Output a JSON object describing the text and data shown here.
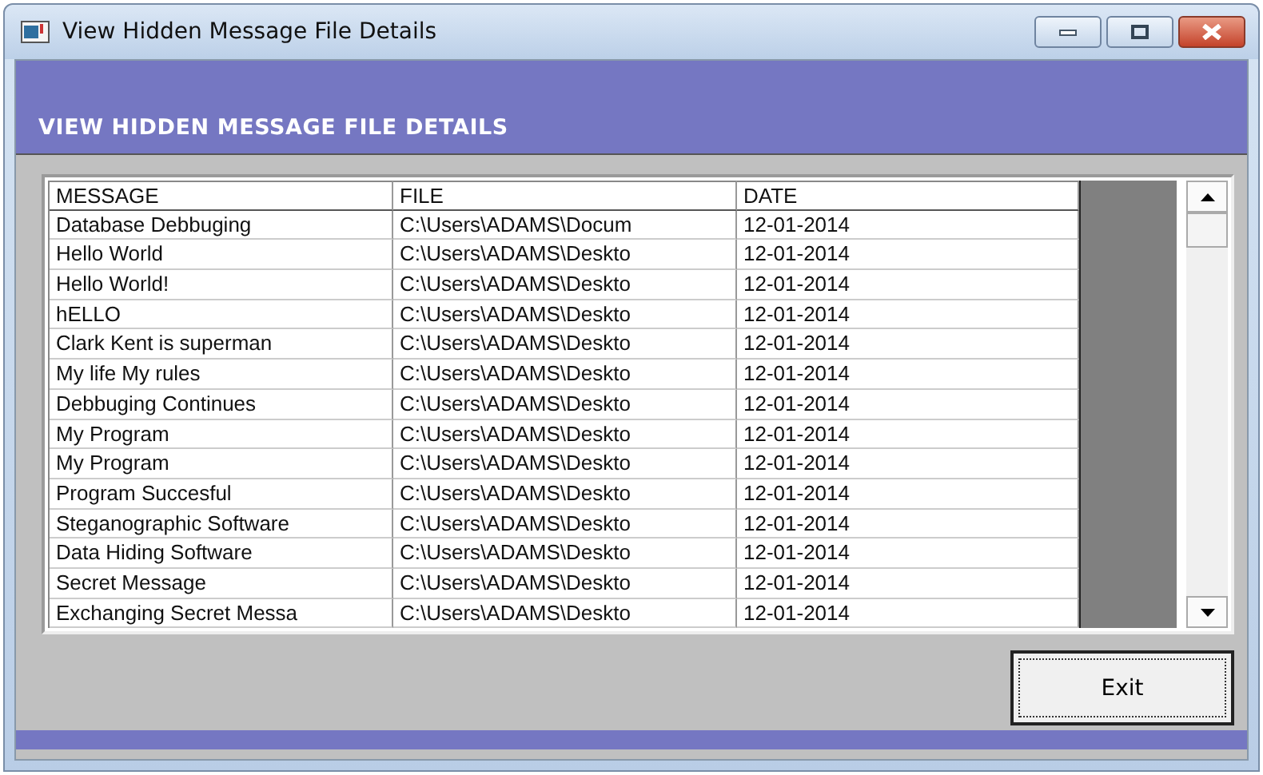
{
  "window": {
    "title": "View Hidden Message File Details"
  },
  "header": {
    "title": "VIEW HIDDEN MESSAGE FILE DETAILS"
  },
  "table": {
    "columns": [
      "MESSAGE",
      "FILE",
      "DATE"
    ],
    "rows": [
      [
        "Database Debbuging",
        "C:\\Users\\ADAMS\\Docum",
        "12-01-2014"
      ],
      [
        "Hello World",
        "C:\\Users\\ADAMS\\Deskto",
        "12-01-2014"
      ],
      [
        "Hello World!",
        "C:\\Users\\ADAMS\\Deskto",
        "12-01-2014"
      ],
      [
        "hELLO",
        "C:\\Users\\ADAMS\\Deskto",
        "12-01-2014"
      ],
      [
        "Clark Kent is superman",
        "C:\\Users\\ADAMS\\Deskto",
        "12-01-2014"
      ],
      [
        "My life My rules",
        "C:\\Users\\ADAMS\\Deskto",
        "12-01-2014"
      ],
      [
        "Debbuging Continues",
        "C:\\Users\\ADAMS\\Deskto",
        "12-01-2014"
      ],
      [
        "My Program",
        "C:\\Users\\ADAMS\\Deskto",
        "12-01-2014"
      ],
      [
        "My Program",
        "C:\\Users\\ADAMS\\Deskto",
        "12-01-2014"
      ],
      [
        "Program Succesful",
        "C:\\Users\\ADAMS\\Deskto",
        "12-01-2014"
      ],
      [
        "Steganographic Software",
        "C:\\Users\\ADAMS\\Deskto",
        "12-01-2014"
      ],
      [
        "Data Hiding Software",
        "C:\\Users\\ADAMS\\Deskto",
        "12-01-2014"
      ],
      [
        "Secret Message",
        "C:\\Users\\ADAMS\\Deskto",
        "12-01-2014"
      ],
      [
        "Exchanging Secret Messa",
        "C:\\Users\\ADAMS\\Deskto",
        "12-01-2014"
      ]
    ]
  },
  "buttons": [
    {
      "label": "Exit"
    }
  ]
}
